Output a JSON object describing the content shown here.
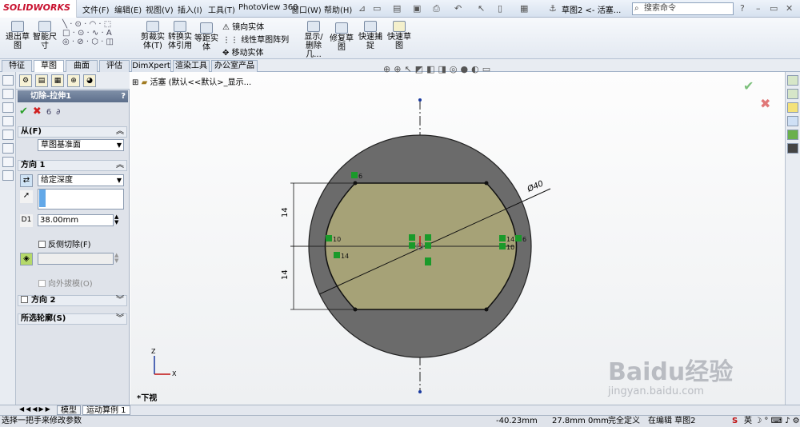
{
  "app": {
    "logo_text": "SOLIDWORKS",
    "brand_color": "#c8102e"
  },
  "menu": [
    "文件(F)",
    "编辑(E)",
    "视图(V)",
    "插入(I)",
    "工具(T)",
    "PhotoView 360",
    "窗口(W)",
    "帮助(H)"
  ],
  "document_title": "草图2 <- 活塞...",
  "search": {
    "placeholder": "搜索命令"
  },
  "ribbon": {
    "exit_sketch": "退出草图",
    "smart_dimension": "智能尺寸",
    "trim": "剪裁实体(T)",
    "convert": "转换实体引用",
    "offset": "等距实体",
    "mirror": "镜向实体",
    "linear_pattern": "线性草图阵列",
    "move": "移动实体",
    "display_delete": "显示/删除几...",
    "repair": "修复草图",
    "quick_snap": "快速捕捉",
    "rapid_sketch": "快速草图"
  },
  "tabs": [
    "特征",
    "草图",
    "曲面",
    "评估",
    "DimXpert",
    "渲染工具",
    "办公室产品"
  ],
  "active_tab": 1,
  "feature": {
    "title": "切除-拉伸1",
    "help": "?",
    "from_section": "从(F)",
    "from_value": "草图基准面",
    "direction1_section": "方向 1",
    "end_condition": "给定深度",
    "depth": "38.00mm",
    "flip_side": "反侧切除(F)",
    "draft_outward": "向外拔模(O)",
    "direction2_section": "方向 2",
    "selected_contours_section": "所选轮廓(S)"
  },
  "tree": {
    "root": "活塞 (默认<<默认>_显示..."
  },
  "drawing": {
    "diameter_label": "Ø40",
    "dim_top": "14",
    "dim_bottom": "14",
    "relation_labels": [
      "6",
      "10",
      "14",
      "14",
      "6",
      "10"
    ]
  },
  "view_label": "*下视",
  "axis": {
    "z": "Z",
    "x": "X"
  },
  "bottom_tabs": [
    "模型",
    "运动算例 1"
  ],
  "status": {
    "message": "选择一把手来修改参数",
    "x": "-40.23mm",
    "y": "27.8mm",
    "z": "0mm",
    "state": "完全定义",
    "editing": "在编辑 草图2"
  },
  "watermark": {
    "text": "Baidu经验",
    "sub": "jingyan.baidu.com"
  },
  "colors": {
    "body_gray": "#6b6b6b",
    "profile_fill": "#a6a277",
    "confirm_green": "#2aa02a",
    "cancel_red": "#d02020"
  }
}
